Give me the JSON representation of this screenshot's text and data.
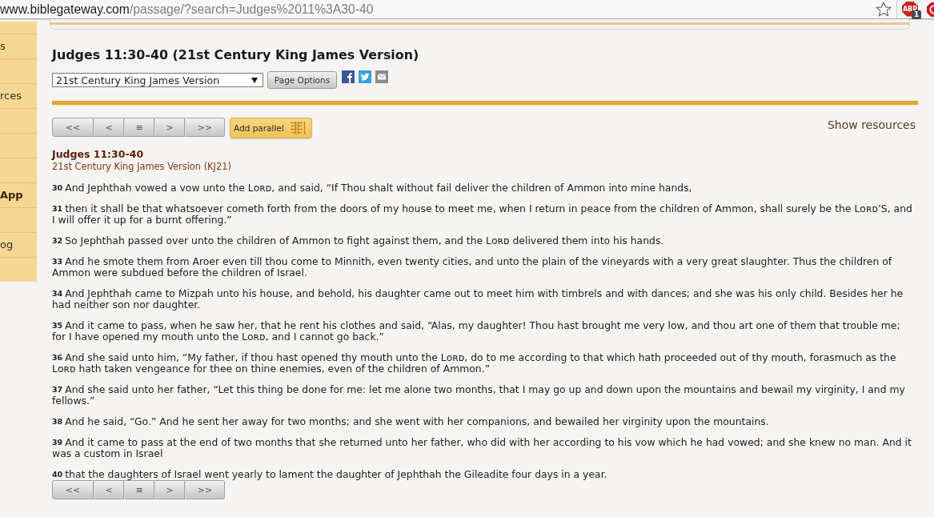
{
  "address_bar": {
    "host": "www.biblegateway.com",
    "path": "/passage/?search=Judges%2011%3A30-40"
  },
  "extensions": [
    {
      "label": "ABP",
      "badge": "1"
    }
  ],
  "sidebar": {
    "items": [
      {
        "label": "s",
        "bold": false
      },
      {
        "label": "rces",
        "bold": false
      },
      {
        "label": "App",
        "bold": true
      },
      {
        "label": "og",
        "bold": false
      }
    ]
  },
  "heading": "Judges 11:30-40 (21st Century King James Version)",
  "version_select": {
    "value": "21st Century King James Version"
  },
  "page_options_button": "Page Options",
  "nav_top": [
    "<<",
    "<",
    "≡",
    ">",
    ">>"
  ],
  "add_parallel_button": "Add parallel",
  "show_resources": "Show resources",
  "passage": {
    "title": "Judges 11:30-40",
    "version": "21st Century King James Version (KJ21)",
    "verses": [
      {
        "number": "30",
        "text": "And Jephthah vowed a vow unto the Lᴏʀᴅ, and said, “If Thou shalt without fail deliver the children of Ammon into mine hands,"
      },
      {
        "number": "31",
        "text": "then it shall be that whatsoever cometh forth from the doors of my house to meet me, when I return in peace from the children of Ammon, shall surely be the Lᴏʀᴅ’S, and I will offer it up for a burnt offering.”"
      },
      {
        "number": "32",
        "text": "So Jephthah passed over unto the children of Ammon to fight against them, and the Lᴏʀᴅ delivered them into his hands."
      },
      {
        "number": "33",
        "text": "And he smote them from Aroer even till thou come to Minnith, even twenty cities, and unto the plain of the vineyards with a very great slaughter. Thus the children of Ammon were subdued before the children of Israel."
      },
      {
        "number": "34",
        "text": "And Jephthah came to Mizpah unto his house, and behold, his daughter came out to meet him with timbrels and with dances; and she was his only child. Besides her he had neither son nor daughter."
      },
      {
        "number": "35",
        "text": "And it came to pass, when he saw her, that he rent his clothes and said, “Alas, my daughter! Thou hast brought me very low, and thou art one of them that trouble me; for I have opened my mouth unto the Lᴏʀᴅ, and I cannot go back.”"
      },
      {
        "number": "36",
        "text": "And she said unto him, “My father, if thou hast opened thy mouth unto the Lᴏʀᴅ, do to me according to that which hath proceeded out of thy mouth, forasmuch as the Lᴏʀᴅ hath taken vengeance for thee on thine enemies, even of the children of Ammon.”"
      },
      {
        "number": "37",
        "text": "And she said unto her father, “Let this thing be done for me: let me alone two months, that I may go up and down upon the mountains and bewail my virginity, I and my fellows.”"
      },
      {
        "number": "38",
        "text": "And he said, “Go.” And he sent her away for two months; and she went with her companions, and bewailed her virginity upon the mountains."
      },
      {
        "number": "39",
        "text": "And it came to pass at the end of two months that she returned unto her father, who did with her according to his vow which he had vowed; and she knew no man. And it was a custom in Israel"
      },
      {
        "number": "40",
        "text": "that the daughters of Israel went yearly to lament the daughter of Jephthah the Gileadite four days in a year."
      }
    ]
  },
  "nav_bottom": [
    "<<",
    "<",
    "≡",
    ">",
    ">>"
  ]
}
